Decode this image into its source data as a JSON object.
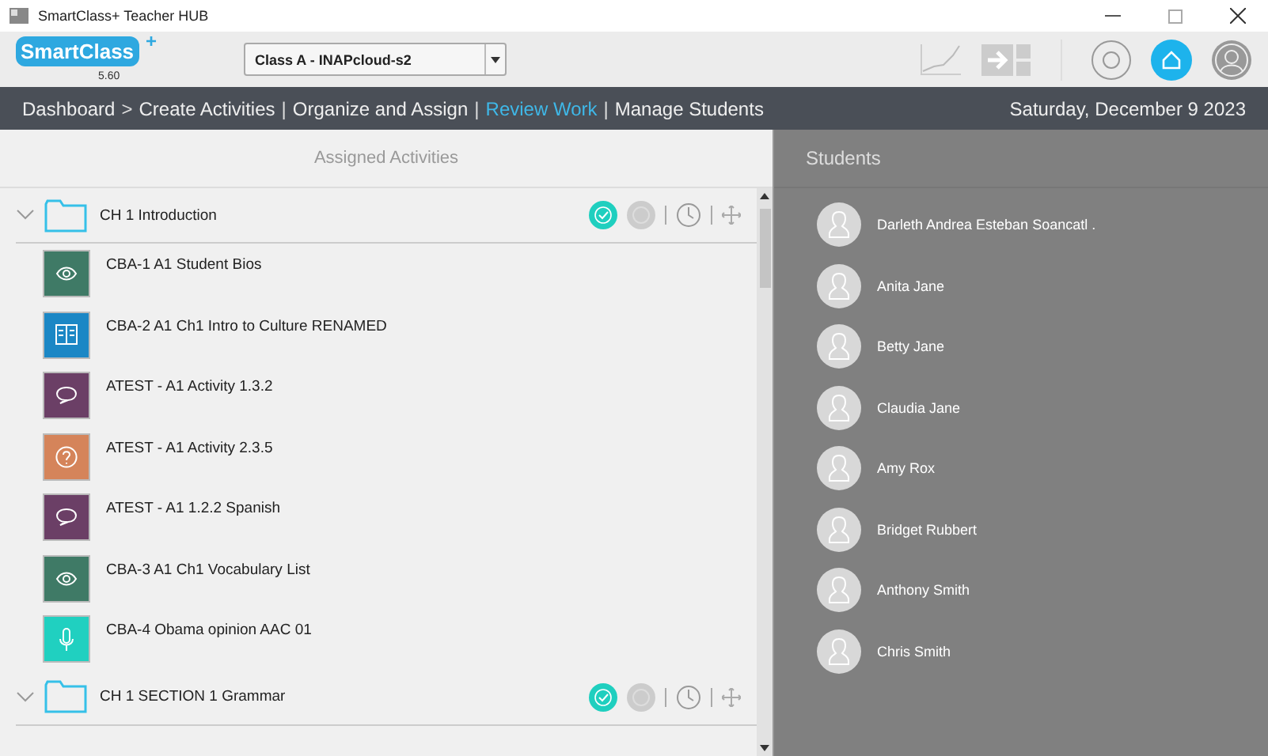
{
  "window": {
    "title": "SmartClass+ Teacher HUB"
  },
  "logo": {
    "name": "SmartClass",
    "plus": "+",
    "version": "5.60"
  },
  "class_select": {
    "value": "Class A - INAPcloud-s2"
  },
  "nav": [
    {
      "label": "Dashboard",
      "selected": false
    },
    {
      "label": "Create Activities",
      "separator_before": ">",
      "selected": false
    },
    {
      "label": "Organize and Assign",
      "separator_before": "|",
      "selected": false
    },
    {
      "label": "Review Work",
      "separator_before": "|",
      "selected": true
    },
    {
      "label": "Manage Students",
      "separator_before": "|",
      "selected": false
    }
  ],
  "date": "Saturday, December 9 2023",
  "activities_panel": {
    "title": "Assigned Activities",
    "groups": [
      {
        "title": "CH 1 Introduction",
        "expanded": true,
        "items": [
          {
            "name": "CBA-1 A1 Student Bios",
            "kind": "eye",
            "color": "#3f7a66"
          },
          {
            "name": "CBA-2 A1 Ch1 Intro to Culture RENAMED",
            "kind": "book",
            "color": "#1b87c5"
          },
          {
            "name": "ATEST - A1 Activity 1.3.2",
            "kind": "chat",
            "color": "#6b3f66"
          },
          {
            "name": "ATEST - A1 Activity 2.3.5",
            "kind": "question",
            "color": "#d5845a"
          },
          {
            "name": "ATEST - A1 1.2.2 Spanish",
            "kind": "chat",
            "color": "#6b3f66"
          },
          {
            "name": "CBA-3 A1 Ch1 Vocabulary List",
            "kind": "eye",
            "color": "#3f7a66"
          },
          {
            "name": "CBA-4 Obama opinion AAC 01",
            "kind": "mic",
            "color": "#20d0c0"
          }
        ]
      },
      {
        "title": "CH 1 SECTION 1 Grammar",
        "expanded": true
      }
    ]
  },
  "students_panel": {
    "title": "Students",
    "students": [
      "Darleth Andrea Esteban Soancatl .",
      "Anita Jane",
      "Betty Jane",
      "Claudia Jane",
      "Amy Rox",
      "Bridget Rubbert",
      "Anthony Smith",
      "Chris Smith"
    ]
  }
}
